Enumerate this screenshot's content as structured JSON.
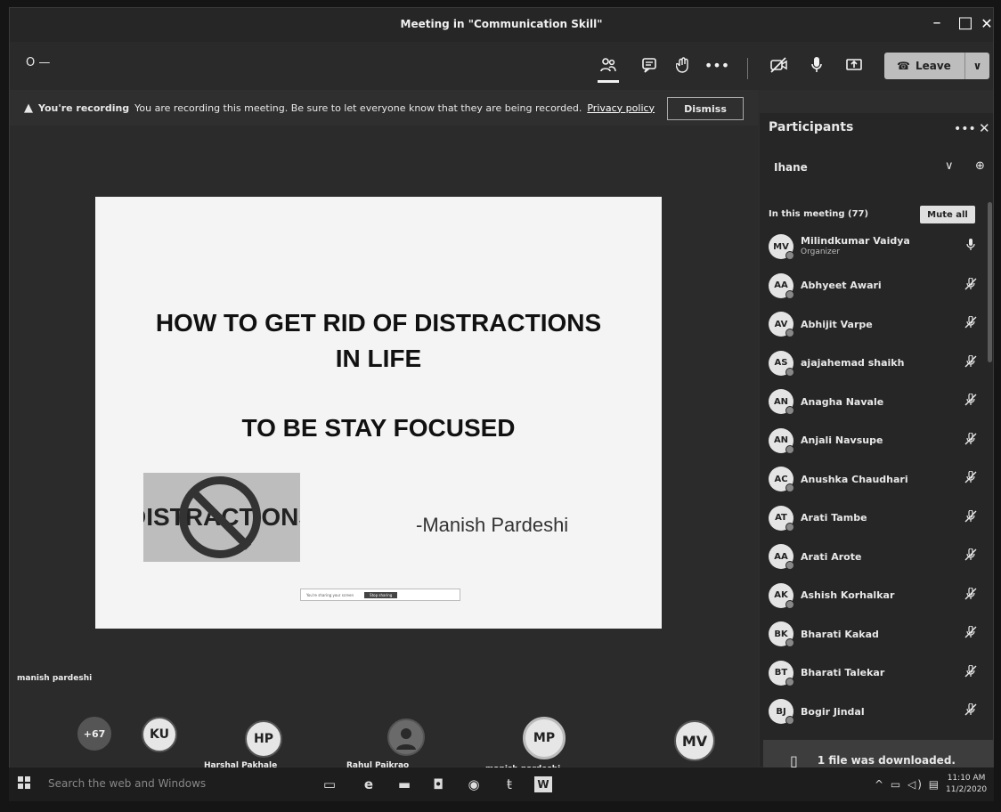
{
  "window": {
    "title": "Meeting in \"Communication Skill\"",
    "min": "–",
    "max": "□",
    "close": "✕"
  },
  "toolbar": {
    "timer": "O —",
    "participants_icon": "people-icon",
    "chat_icon": "chat-icon",
    "raise_hand_icon": "hand-icon",
    "more_icon": "more-icon",
    "camera_off_icon": "camera-off-icon",
    "mic_icon": "mic-icon",
    "share_icon": "share-icon",
    "leave_label": "Leave",
    "leave_chevron": "∨"
  },
  "banner": {
    "strong": "You're recording",
    "message": "You are recording this meeting. Be sure to let everyone know that they are being recorded.",
    "link": "Privacy policy",
    "dismiss": "Dismiss"
  },
  "slide": {
    "title_line1": "HOW TO GET RID OF DISTRACTIONS",
    "title_line2": "IN LIFE",
    "subtitle": "TO BE STAY FOCUSED",
    "image_text": "DISTRACTIONS",
    "author": "-Manish Pardeshi",
    "sharing_text": "You're sharing your screen",
    "stop_sharing": "Stop sharing"
  },
  "stage": {
    "presenter_name": "manish pardeshi",
    "tiles": [
      {
        "initials": "+67",
        "name": ""
      },
      {
        "initials": "KU",
        "name": ""
      },
      {
        "initials": "HP",
        "name": "Harshal Pakhale"
      },
      {
        "initials": "",
        "name": "Rahul Paikrao"
      },
      {
        "initials": "MP",
        "name": "manish pardeshi"
      },
      {
        "initials": "MV",
        "name": ""
      }
    ]
  },
  "participants": {
    "title": "Participants",
    "search_value": "Ihane",
    "in_meeting": "In this meeting (77)",
    "mute_all": "Mute all",
    "list": [
      {
        "initials": "MV",
        "name": "Milindkumar Vaidya",
        "role": "Organizer",
        "mic": "on"
      },
      {
        "initials": "AA",
        "name": "Abhyeet Awari",
        "role": "",
        "mic": "off"
      },
      {
        "initials": "AV",
        "name": "Abhijit Varpe",
        "role": "",
        "mic": "off"
      },
      {
        "initials": "AS",
        "name": "ajajahemad shaikh",
        "role": "",
        "mic": "off"
      },
      {
        "initials": "AN",
        "name": "Anagha Navale",
        "role": "",
        "mic": "off"
      },
      {
        "initials": "AN",
        "name": "Anjali Navsupe",
        "role": "",
        "mic": "off"
      },
      {
        "initials": "AC",
        "name": "Anushka Chaudhari",
        "role": "",
        "mic": "off"
      },
      {
        "initials": "AT",
        "name": "Arati Tambe",
        "role": "",
        "mic": "off"
      },
      {
        "initials": "AA",
        "name": "Arati Arote",
        "role": "",
        "mic": "off"
      },
      {
        "initials": "AK",
        "name": "Ashish Korhalkar",
        "role": "",
        "mic": "off"
      },
      {
        "initials": "BK",
        "name": "Bharati Kakad",
        "role": "",
        "mic": "off"
      },
      {
        "initials": "BT",
        "name": "Bharati Talekar",
        "role": "",
        "mic": "off"
      },
      {
        "initials": "BJ",
        "name": "Bogir Jindal",
        "role": "",
        "mic": "off"
      }
    ]
  },
  "toast": {
    "message": "1 file was downloaded."
  },
  "taskbar": {
    "search_placeholder": "Search the web and Windows",
    "time": "11:10 AM",
    "date": "11/2/2020"
  }
}
